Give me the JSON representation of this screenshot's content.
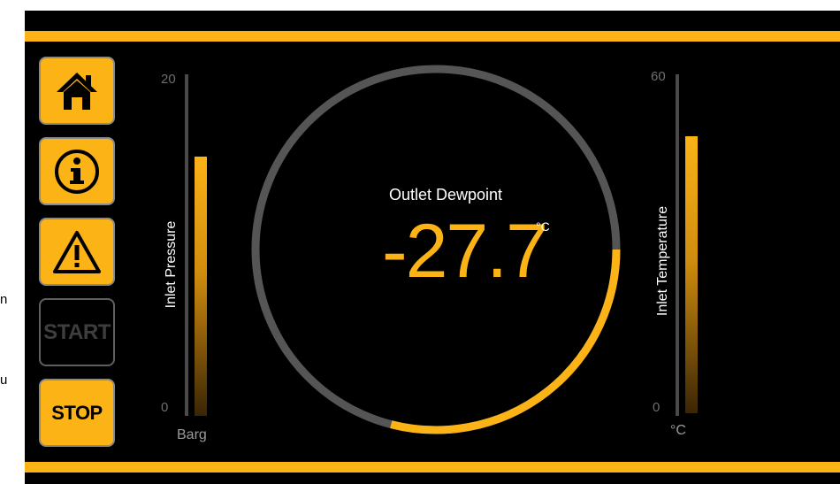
{
  "side_fragments": [
    "n",
    "u"
  ],
  "nav": {
    "home_icon": "home-icon",
    "info_icon": "info-icon",
    "warning_icon": "warning-icon",
    "start_label": "START",
    "stop_label": "STOP"
  },
  "inlet_pressure": {
    "label": "Inlet Pressure",
    "max": "20",
    "min": "0",
    "unit": "Barg",
    "level_fraction": 0.76
  },
  "outlet_dewpoint": {
    "label": "Outlet Dewpoint",
    "value": "-27.7",
    "unit": "°C",
    "gauge_fraction": 0.29
  },
  "inlet_temperature": {
    "label": "Inlet Temperature",
    "max": "60",
    "min": "0",
    "unit": "°C",
    "level_fraction": 0.81
  },
  "colors": {
    "accent": "#fbb316",
    "background": "#000000",
    "track": "#4a4a4a",
    "text": "#ffffff"
  }
}
